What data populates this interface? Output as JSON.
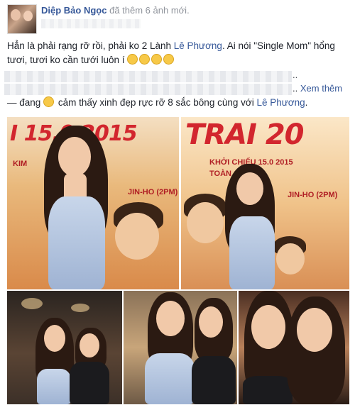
{
  "header": {
    "author": "Diệp Bảo Ngọc",
    "action": "đã thêm 6 ảnh mới."
  },
  "post": {
    "line1_a": "Hẳn là phải rạng rỡ rồi, phải ko 2 Lành ",
    "line1_mention": "Lê Phương",
    "line1_b": ". Ai nói \"Single Mom\" hổng",
    "line2": "tươi, tươi ko cần tưới luôn í",
    "dots": "..",
    "see_more_dots": "..",
    "see_more": "Xem thêm",
    "feeling_a": "— đang",
    "feeling_b": "cảm thấy xinh đẹp rực rỡ 8 sắc bông cùng với ",
    "feeling_mention": "Lê Phương",
    "feeling_end": "."
  },
  "photos": {
    "poster1_title": "I 15.0 2015",
    "poster1_sub": "KIM",
    "poster1_sub2": "JIN-HO (2PM)",
    "poster2_title": "TRAI 20",
    "poster2_sub": "KHỞI CHIẾU 15.0 2015",
    "poster2_sub2": "TOÀN QUỐC",
    "poster2_sub3": "JIN-HO (2PM)"
  },
  "colors": {
    "link": "#365899",
    "poster_red": "#d2262e"
  }
}
